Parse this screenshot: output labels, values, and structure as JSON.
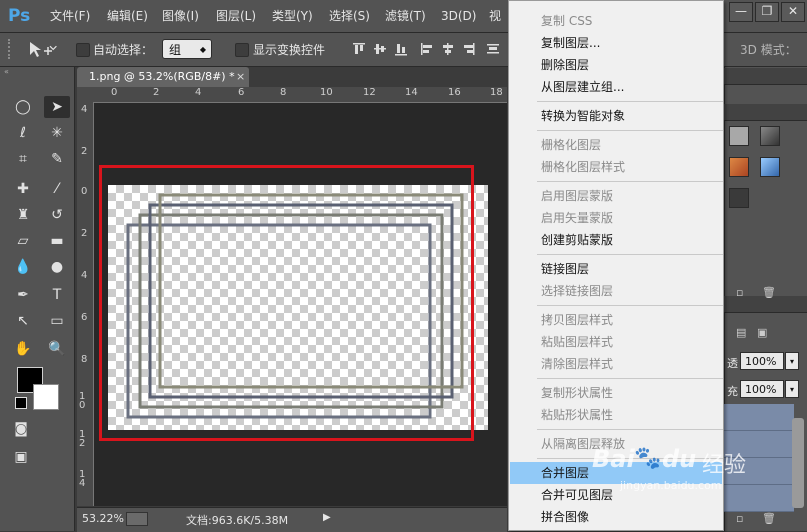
{
  "app": {
    "logo": "Ps",
    "menus": [
      "文件(F)",
      "编辑(E)",
      "图像(I)",
      "图层(L)",
      "类型(Y)",
      "选择(S)",
      "滤镜(T)",
      "3D(D)",
      "视"
    ],
    "window_controls": {
      "minimize": "—",
      "restore": "❐",
      "close": "✕"
    }
  },
  "options_bar": {
    "auto_select_label": "自动选择：",
    "auto_select_value": "组",
    "show_transform_label": "显示变换控件",
    "mode_label": "3D 模式："
  },
  "document": {
    "tab_title": "1.png @ 53.2%(RGB/8#) *",
    "tab_close": "×",
    "ruler_h": [
      "0",
      "2",
      "4",
      "6",
      "8",
      "10",
      "12",
      "14",
      "16",
      "18"
    ],
    "ruler_v": [
      "4",
      "2",
      "0",
      "2",
      "4",
      "6",
      "8",
      "1 0",
      "1 2",
      "1 4"
    ]
  },
  "status_bar": {
    "zoom": "53.22%",
    "doc_info": "文档:963.6K/5.38M",
    "arrow": "▶"
  },
  "right_panel": {
    "opacity_label": "透：",
    "opacity_value": "100%",
    "fill_label": "充：",
    "fill_value": "100%",
    "arrow": "▾"
  },
  "context_menu": {
    "items": [
      {
        "label": "复制 CSS",
        "enabled": false
      },
      {
        "label": "复制图层...",
        "enabled": true
      },
      {
        "label": "删除图层",
        "enabled": true
      },
      {
        "label": "从图层建立组...",
        "enabled": true
      },
      {
        "label": "转换为智能对象",
        "enabled": true
      },
      {
        "label": "栅格化图层",
        "enabled": false
      },
      {
        "label": "栅格化图层样式",
        "enabled": false
      },
      {
        "label": "启用图层蒙版",
        "enabled": false
      },
      {
        "label": "启用矢量蒙版",
        "enabled": false
      },
      {
        "label": "创建剪贴蒙版",
        "enabled": true
      },
      {
        "label": "链接图层",
        "enabled": true
      },
      {
        "label": "选择链接图层",
        "enabled": false
      },
      {
        "label": "拷贝图层样式",
        "enabled": false
      },
      {
        "label": "粘贴图层样式",
        "enabled": false
      },
      {
        "label": "清除图层样式",
        "enabled": false
      },
      {
        "label": "复制形状属性",
        "enabled": false
      },
      {
        "label": "粘贴形状属性",
        "enabled": false
      },
      {
        "label": "从隔离图层释放",
        "enabled": false
      },
      {
        "label": "合并图层",
        "enabled": true,
        "highlighted": true
      },
      {
        "label": "合并可见图层",
        "enabled": true
      },
      {
        "label": "拼合图像",
        "enabled": true
      }
    ]
  },
  "watermark": {
    "brand": "Bai",
    "brand_2": "du",
    "brand_suffix": "经验",
    "url": "jingyan.baidu.com"
  },
  "colors": {
    "accent_red": "#d8141c",
    "menu_highlight": "#91c9f7",
    "ps_blue": "#4ea7e8"
  }
}
